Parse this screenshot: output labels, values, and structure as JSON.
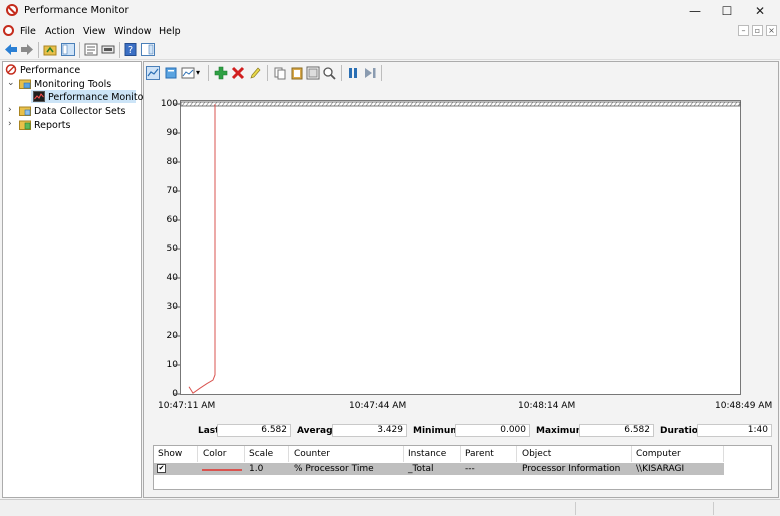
{
  "window": {
    "title": "Performance Monitor",
    "minimize_glyph": "—",
    "maximize_glyph": "☐",
    "close_glyph": "✕"
  },
  "menu": {
    "items": [
      "File",
      "Action",
      "View",
      "Window",
      "Help"
    ]
  },
  "tree": {
    "root": "Performance",
    "monitoring_tools": "Monitoring Tools",
    "performance_monitor": "Performance Monitor",
    "data_collector_sets": "Data Collector Sets",
    "reports": "Reports"
  },
  "graph": {
    "y_ticks": [
      "100",
      "90",
      "80",
      "70",
      "60",
      "50",
      "40",
      "30",
      "20",
      "10",
      "0"
    ],
    "x_ticks": [
      "10:47:11 AM",
      "10:47:44 AM",
      "10:48:14 AM",
      "10:48:49 AM"
    ],
    "line_color": "#d9534f"
  },
  "chart_data": {
    "type": "line",
    "ylim": [
      0,
      100
    ],
    "series": [
      {
        "name": "% Processor Time",
        "values": [
          2.5,
          0.3,
          2.0,
          3.6,
          4.8,
          6.6,
          100
        ]
      }
    ]
  },
  "stats": {
    "last_label": "Last",
    "last_value": "6.582",
    "average_label": "Average",
    "average_value": "3.429",
    "minimum_label": "Minimum",
    "minimum_value": "0.000",
    "maximum_label": "Maximum",
    "maximum_value": "6.582",
    "duration_label": "Duration",
    "duration_value": "1:40"
  },
  "counters": {
    "headers": [
      "Show",
      "Color",
      "Scale",
      "Counter",
      "Instance",
      "Parent",
      "Object",
      "Computer"
    ],
    "row": {
      "show": "✔",
      "scale": "1.0",
      "counter": "% Processor Time",
      "instance": "_Total",
      "parent": "---",
      "object": "Processor Information",
      "computer": "\\\\KISARAGI",
      "color": "#d9534f"
    }
  }
}
